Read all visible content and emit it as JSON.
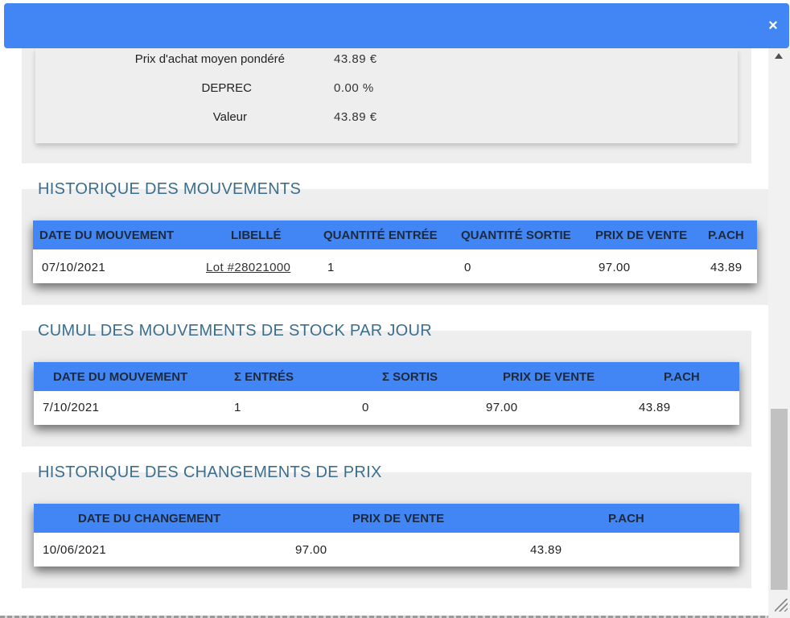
{
  "dialog": {
    "close_icon": "×"
  },
  "stats": {
    "pamp_label": "Prix d'achat moyen pondéré",
    "pamp_value": "43.89 €",
    "deprec_label": "DEPREC",
    "deprec_value": "0.00 %",
    "valeur_label": "Valeur",
    "valeur_value": "43.89 €"
  },
  "historique": {
    "title": "HISTORIQUE DES MOUVEMENTS",
    "headers": [
      "DATE DU MOUVEMENT",
      "LIBELLÉ",
      "QUANTITÉ ENTRÉE",
      "QUANTITÉ SORTIE",
      "PRIX DE VENTE",
      "P.ACH"
    ],
    "rows": [
      [
        "07/10/2021",
        "Lot #28021000",
        "1",
        "0",
        "97.00",
        "43.89"
      ]
    ]
  },
  "cumul": {
    "title": "CUMUL DES MOUVEMENTS DE STOCK PAR JOUR",
    "headers": [
      "DATE DU MOUVEMENT",
      "Σ ENTRÉS",
      "Σ SORTIS",
      "PRIX DE VENTE",
      "P.ACH"
    ],
    "rows": [
      [
        "7/10/2021",
        "1",
        "0",
        "97.00",
        "43.89"
      ]
    ]
  },
  "prix": {
    "title": "HISTORIQUE DES CHANGEMENTS DE PRIX",
    "headers": [
      "DATE DU CHANGEMENT",
      "PRIX DE VENTE",
      "P.ACH"
    ],
    "rows": [
      [
        "10/06/2021",
        "97.00",
        "43.89"
      ]
    ]
  }
}
